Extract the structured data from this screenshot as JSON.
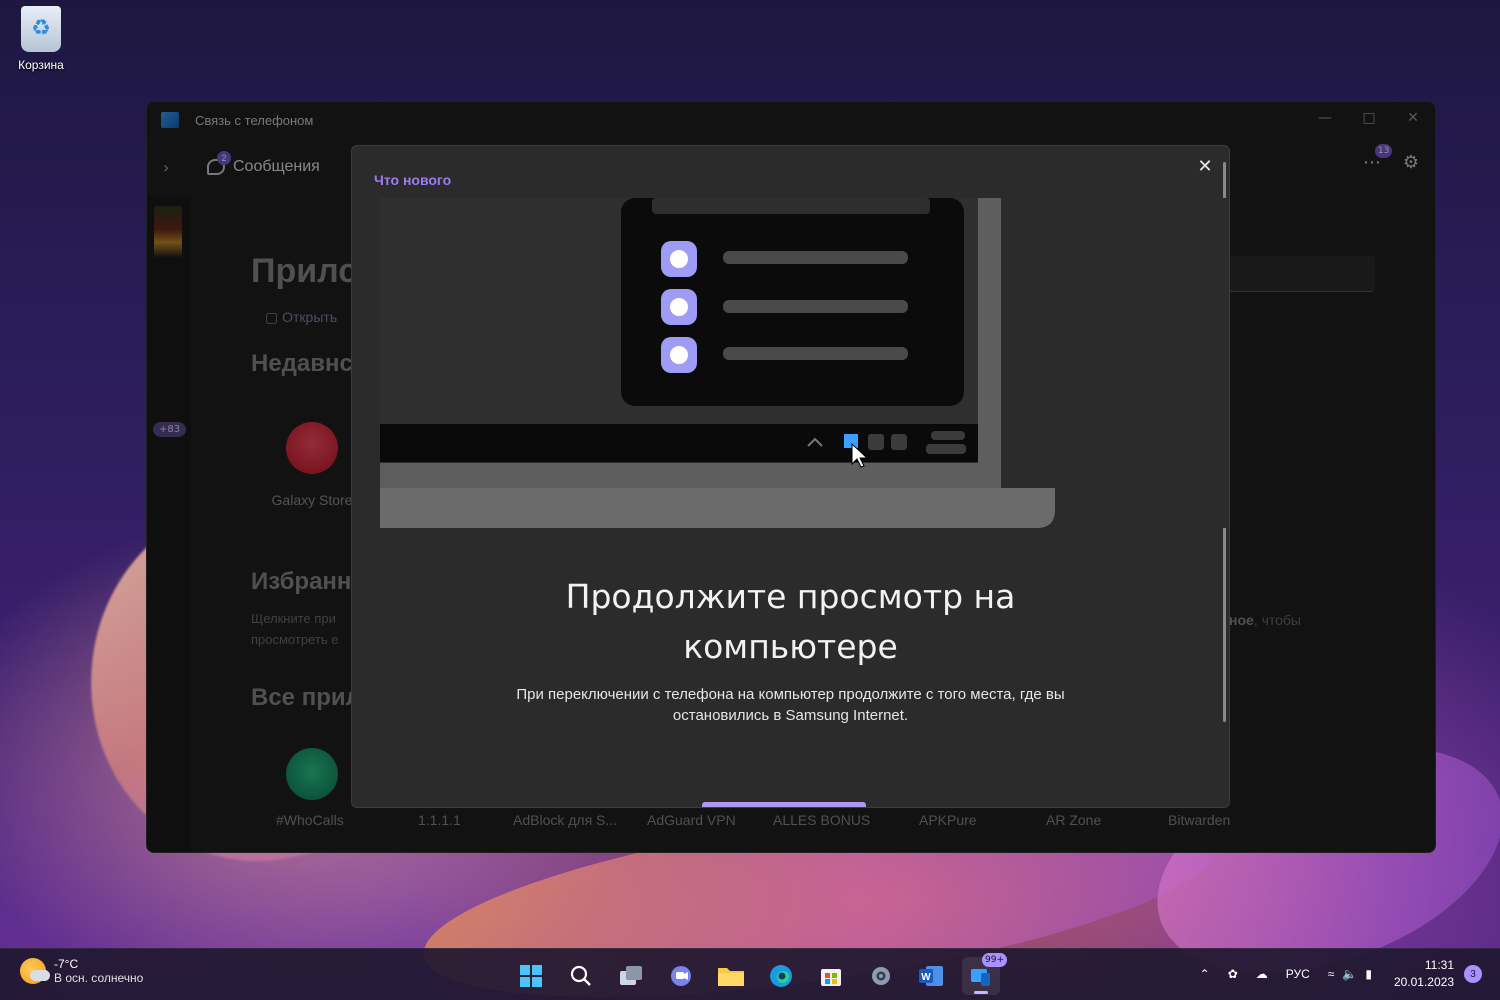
{
  "desktop": {
    "recycle_bin_label": "Корзина"
  },
  "app": {
    "title": "Связь с телефоном",
    "nav": {
      "messages_tab": "Сообщения",
      "messages_badge": "2",
      "more_badge": "13"
    },
    "rail_badge": "+83",
    "main": {
      "heading": "Прилс",
      "open_link": "Открыть",
      "recent_heading": "Недавнс",
      "recent_app": "Galaxy Store",
      "favorites_heading": "Избранн",
      "favorites_hint_line1": "Щелкните при",
      "favorites_hint_line2": "просмотреть е",
      "favorites_hint_right_bold": "ное",
      "favorites_hint_right_rest": ", чтобы",
      "all_apps_heading": "Все прил",
      "all_apps": [
        "#WhoCalls",
        "1.1.1.1",
        "AdBlock для S...",
        "AdGuard VPN",
        "ALLES BONUS",
        "APKPure",
        "AR Zone",
        "Bitwarden"
      ]
    }
  },
  "modal": {
    "tag": "Что нового",
    "title_line1": "Продолжите просмотр на",
    "title_line2": "компьютере",
    "description": "При переключении с телефона на компьютер продолжите с того места, где вы остановились в Samsung Internet."
  },
  "taskbar": {
    "weather_temp": "-7°C",
    "weather_desc": "В осн. солнечно",
    "phone_link_badge": "99+",
    "language": "РУС",
    "time": "11:31",
    "date": "20.01.2023",
    "notifications_count": "3"
  },
  "colors": {
    "accent": "#9c7df0",
    "app_bg": "#202020",
    "modal_bg": "#2b2b2b"
  }
}
